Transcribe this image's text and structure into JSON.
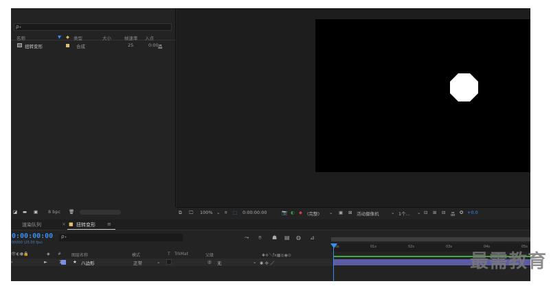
{
  "project": {
    "search_icon_text": "ρ₊",
    "columns": {
      "name": "名称",
      "type": "类型",
      "size": "大小",
      "fps": "帧速率",
      "in": "入点"
    },
    "items": [
      {
        "name": "扭转变形",
        "type": "合成",
        "fps": "25",
        "in": "0:00"
      }
    ],
    "bpc": "8 bpc"
  },
  "viewer": {
    "zoom": "100%",
    "timecode": "0:00:00:00",
    "quality": "(完整)",
    "camera": "活动摄像机",
    "views": "1个...",
    "exposure": "+0.0"
  },
  "timeline": {
    "tabs": {
      "render_queue": "渲染队列",
      "comp": "扭转变形",
      "menu": "≡"
    },
    "current_time": "0:00:00:00",
    "fps_label": "00000 (25.00 fps)",
    "search_icon_text": "ρ₊",
    "headers": {
      "number": "#",
      "layer_name": "图层名称",
      "mode": "模式",
      "t": "T",
      "trkmat": "TrkMat",
      "parent": "父级"
    },
    "layers": [
      {
        "number": "1",
        "star": "★",
        "name": "八边形",
        "mode": "正常",
        "parent": "无"
      }
    ],
    "ruler_labels": [
      "0s",
      "01s",
      "02s",
      "03s",
      "04s",
      "05s"
    ]
  },
  "watermark": "最需教育",
  "colors": {
    "accent": "#3a8ef0",
    "layer_bar": "#5c5ba5",
    "label": "#7b8de8"
  }
}
